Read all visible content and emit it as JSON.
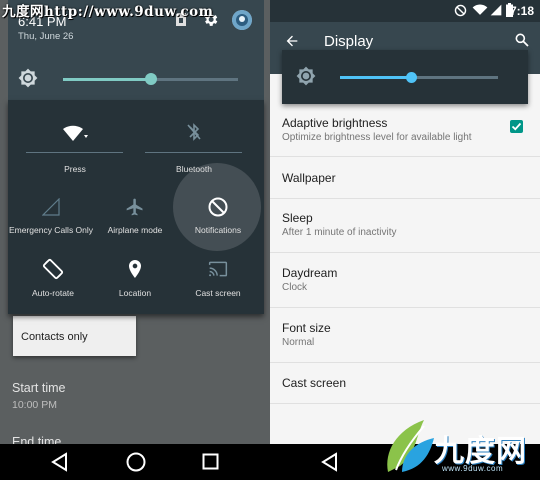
{
  "watermark": "九度网http://www.9duw.com",
  "left": {
    "time": "6:41 PM",
    "date": "Thu, June 26",
    "brightness_level": 0.5,
    "tiles": [
      {
        "id": "wifi",
        "label": "Press",
        "icon": "wifi-icon"
      },
      {
        "id": "bluetooth",
        "label": "Bluetooth",
        "icon": "bluetooth-off-icon"
      },
      {
        "id": "cellular",
        "label": "Emergency Calls Only",
        "icon": "signal-icon"
      },
      {
        "id": "airplane",
        "label": "Airplane mode",
        "icon": "airplane-icon"
      },
      {
        "id": "notifications",
        "label": "Notifications",
        "icon": "do-not-disturb-icon"
      },
      {
        "id": "rotate",
        "label": "Auto-rotate",
        "icon": "auto-rotate-icon"
      },
      {
        "id": "location",
        "label": "Location",
        "icon": "location-pin-icon"
      },
      {
        "id": "cast",
        "label": "Cast screen",
        "icon": "cast-icon"
      }
    ],
    "popup_option": "Contacts only",
    "background_items": [
      {
        "title": "Start time",
        "subtitle": "10:00 PM"
      },
      {
        "title": "End time",
        "subtitle": ""
      }
    ]
  },
  "right": {
    "clock": "7:18",
    "title": "Display",
    "brightness_level": 0.45,
    "settings": [
      {
        "title": "Adaptive brightness",
        "subtitle": "Optimize brightness level for available light",
        "checked": true
      },
      {
        "title": "Wallpaper",
        "subtitle": ""
      },
      {
        "title": "Sleep",
        "subtitle": "After 1 minute of inactivity"
      },
      {
        "title": "Daydream",
        "subtitle": "Clock"
      },
      {
        "title": "Font size",
        "subtitle": "Normal"
      },
      {
        "title": "Cast screen",
        "subtitle": ""
      }
    ]
  },
  "logo": {
    "text": "九度网",
    "url": "www.9duw.com"
  },
  "colors": {
    "accent_left": "#80cbc4",
    "accent_right": "#4fc3f7",
    "checkbox": "#009688"
  }
}
